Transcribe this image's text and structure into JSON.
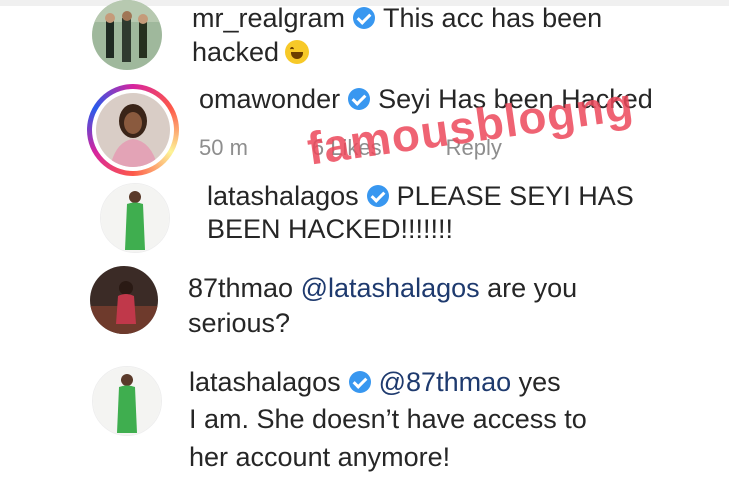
{
  "comments": [
    {
      "username": "mr_realgram",
      "verified": true,
      "text_line1": "This acc has been",
      "text_line2": "hacked",
      "emoji": "laughing-emoji"
    },
    {
      "username": "omawonder",
      "verified": true,
      "text": "Seyi Has been Hacked",
      "time": "50 m",
      "likes": "6 Likes",
      "reply": "Reply"
    },
    {
      "username": "latashalagos",
      "verified": true,
      "text_line1": "PLEASE SEYI HAS",
      "text_line2": "BEEN HACKED!!!!!!!"
    },
    {
      "username": "87thmao",
      "verified": false,
      "mention": "@latashalagos",
      "text_line1": "are you",
      "text_line2": "serious?"
    },
    {
      "username": "latashalagos",
      "verified": true,
      "mention": "@87thmao",
      "text_line1": "yes",
      "text_line2": "I am. She doesn’t have access to",
      "text_line3": "her account anymore!"
    }
  ],
  "watermark": "famousblogng",
  "colors": {
    "verified_badge": "#3897f0",
    "mention": "#1e3a6e",
    "meta_text": "#8e8e8e",
    "watermark": "#ec485a"
  }
}
